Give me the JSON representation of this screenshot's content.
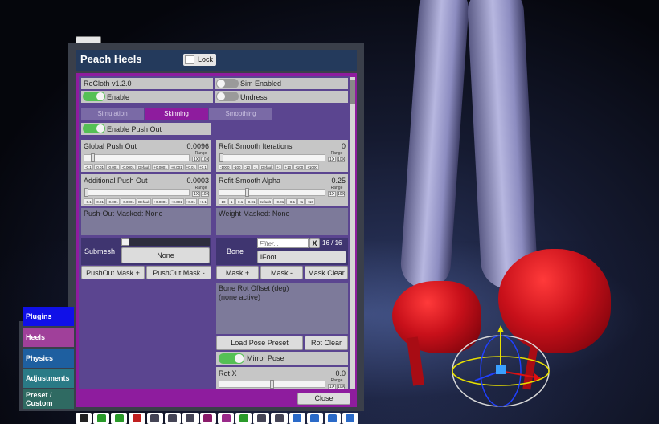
{
  "window": {
    "title": "Peach Heels",
    "lock_label": "Lock",
    "close_label": "Close"
  },
  "recloth": {
    "version": "ReCloth v1.2.0",
    "enable_label": "Enable",
    "sim_enabled_label": "Sim Enabled",
    "undress_label": "Undress",
    "enable_push_out_label": "Enable Push Out"
  },
  "tabs": [
    {
      "label": "Simulation"
    },
    {
      "label": "Skinning"
    },
    {
      "label": "Smoothing"
    }
  ],
  "sliders": {
    "global_push_out": {
      "label": "Global Push Out",
      "value": "0.0096",
      "level": 0.06,
      "range_label": "Range",
      "x1": "1X",
      "x10": "10X",
      "steps": [
        "-0.1",
        "-0.01",
        "-0.001",
        "-0.0001",
        "Default",
        "+0.0001",
        "+0.001",
        "+0.01",
        "+0.1"
      ]
    },
    "refit_smooth_iterations": {
      "label": "Refit Smooth Iterations",
      "value": "0",
      "level": 0.0,
      "range_label": "Range",
      "x1": "1X",
      "x10": "10X",
      "steps": [
        "-1000",
        "-100",
        "-10",
        "-1",
        "Default",
        "+1",
        "+10",
        "+100",
        "+1000"
      ]
    },
    "additional_push_out": {
      "label": "Additional Push Out",
      "value": "0.0003",
      "level": 0.0,
      "range_label": "Range",
      "x1": "1X",
      "x10": "10X",
      "steps": [
        "-0.1",
        "-0.01",
        "-0.001",
        "-0.0001",
        "Default",
        "+0.0001",
        "+0.001",
        "+0.01",
        "+0.1"
      ]
    },
    "refit_smooth_alpha": {
      "label": "Refit Smooth Alpha",
      "value": "0.25",
      "level": 0.25,
      "range_label": "Range",
      "x1": "1X",
      "x10": "10X",
      "steps": [
        "-10",
        "-1",
        "-0.1",
        "-0.01",
        "Default",
        "+0.01",
        "+0.1",
        "+1",
        "+10"
      ]
    },
    "rot_x": {
      "label": "Rot X",
      "value": "0.0",
      "level": 0.5,
      "range_label": "Range",
      "x1": "1X",
      "x10": "10X"
    }
  },
  "push_out_masked": "Push-Out Masked: None",
  "weight_masked": "Weight Masked: None",
  "submesh": {
    "label": "Submesh",
    "value": "None",
    "level": 0.0
  },
  "bone": {
    "label": "Bone",
    "filter_placeholder": "Filter...",
    "clear_label": "X",
    "count": "16 / 16",
    "value": "lFoot"
  },
  "buttons": {
    "pushout_mask_add": "PushOut Mask +",
    "pushout_mask_remove": "PushOut Mask -",
    "mask_add": "Mask +",
    "mask_remove": "Mask -",
    "mask_clear": "Mask Clear",
    "load_pose_preset": "Load Pose Preset",
    "rot_clear": "Rot Clear",
    "mirror_pose": "Mirror Pose"
  },
  "bone_rot": {
    "title": "Bone Rot Offset (deg)",
    "status": "(none active)"
  },
  "side_tabs": [
    {
      "label": "Plugins",
      "color": "#1010e8"
    },
    {
      "label": "Heels",
      "color": "#a0409a"
    },
    {
      "label": "Physics",
      "color": "#1e5fa0"
    },
    {
      "label": "Adjustments",
      "color": "#2a7a86"
    },
    {
      "label": "Preset / Custom",
      "color": "#2f6a62"
    }
  ],
  "toolbar_icons": [
    "menu-icon",
    "shoe-icon",
    "folder-icon",
    "pose-icon",
    "house-icon",
    "box-icon",
    "clothes-icon",
    "body-icon",
    "hand-icon",
    "figure-icon",
    "walk-icon",
    "camera-icon",
    "person-icon",
    "flag-icon",
    "arrow-icon",
    "plus-icon"
  ],
  "colors": {
    "accent": "#8e1c9e",
    "panel": "#5b4590",
    "toggle_on": "#55c055"
  }
}
